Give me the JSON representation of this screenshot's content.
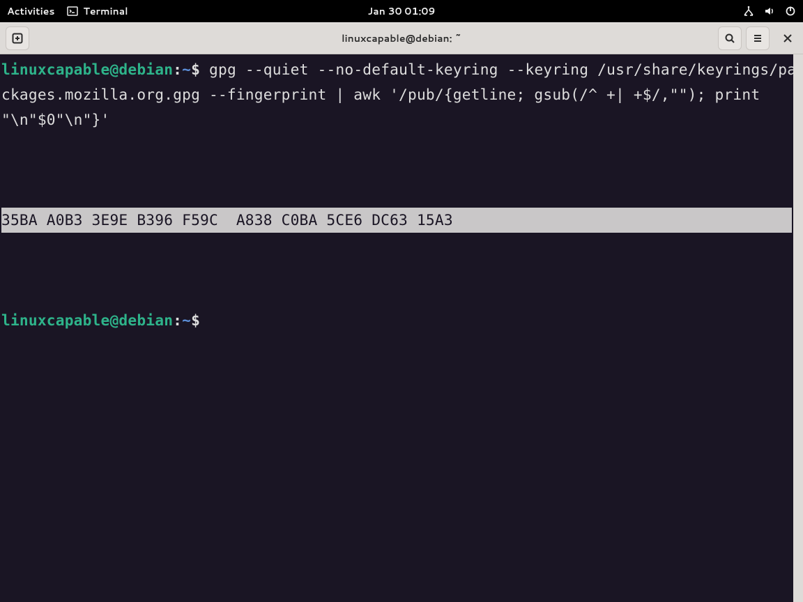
{
  "topbar": {
    "activities": "Activities",
    "app_name": "Terminal",
    "clock": "Jan 30  01:09"
  },
  "titlebar": {
    "title": "linuxcapable@debian: ~"
  },
  "terminal": {
    "prompt_user": "linuxcapable@debian",
    "prompt_sep": ":",
    "prompt_path": "~",
    "prompt_symbol": "$",
    "command": "gpg --quiet --no-default-keyring --keyring /usr/share/keyrings/packages.mozilla.org.gpg --fingerprint | awk '/pub/{getline; gsub(/^ +| +$/,\"\"); print \"\\n\"$0\"\\n\"}'",
    "output_fingerprint": "35BA A0B3 3E9E B396 F59C  A838 C0BA 5CE6 DC63 15A3"
  }
}
